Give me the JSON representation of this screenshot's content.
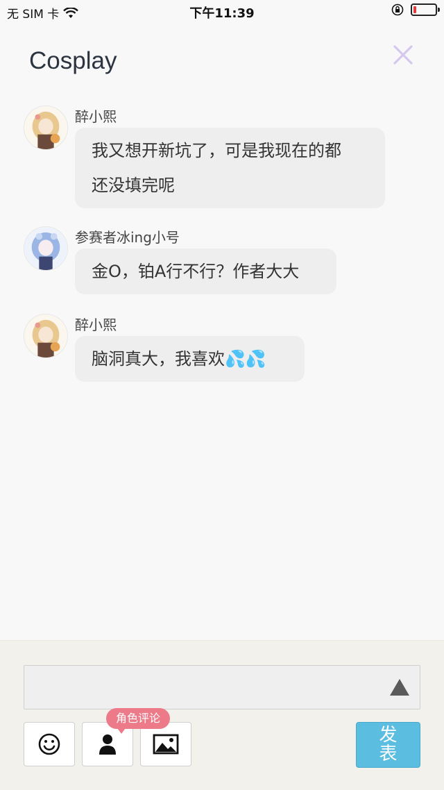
{
  "status_bar": {
    "carrier": "无 SIM 卡",
    "time": "下午11:39",
    "battery_level": 0.12,
    "battery_color": "#e23b3b"
  },
  "header": {
    "title": "Cosplay",
    "close_icon": "close-icon",
    "close_color": "#d6c8ec"
  },
  "messages": [
    {
      "sender": "醉小熙",
      "lines": [
        "我又想开新坑了，可是我现在的都",
        "还没填完呢"
      ],
      "avatar": "avatar-blonde"
    },
    {
      "sender": "参赛者冰ing小号",
      "lines": [
        "金O，铂A行不行？作者大大"
      ],
      "avatar": "avatar-blue"
    },
    {
      "sender": "醉小熙",
      "lines": [
        "脑洞真大，我喜欢💦💦"
      ],
      "avatar": "avatar-blonde"
    }
  ],
  "compose": {
    "input_value": "",
    "send_icon": "triangle-up-icon",
    "emoji_icon": "smiley-icon",
    "role_icon": "person-icon",
    "image_icon": "image-icon",
    "role_badge": "角色评论",
    "publish_label_top": "发",
    "publish_label_bottom": "表",
    "publish_color": "#5bbde0"
  }
}
